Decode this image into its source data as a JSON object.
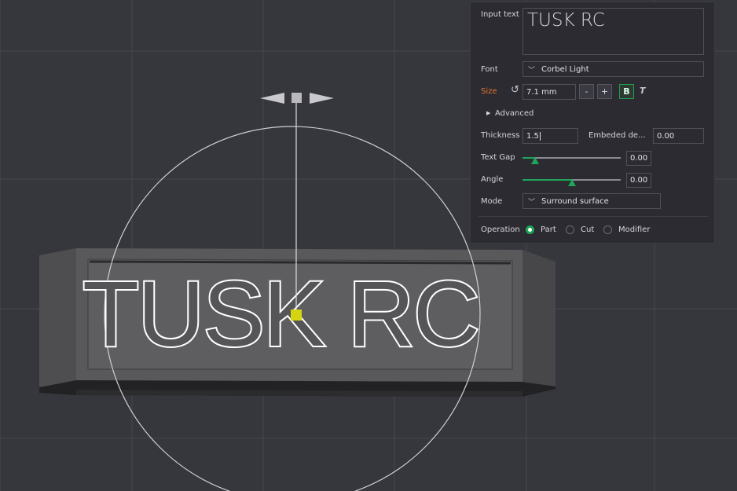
{
  "scene": {
    "embossed_text": "TUSK RC"
  },
  "panel": {
    "input_text_label": "Input text",
    "input_text_value": "TUSK RC",
    "font_label": "Font",
    "font_value": "Corbel Light",
    "size_label": "Size",
    "size_value": "7.1 mm",
    "size_minus": "-",
    "size_plus": "+",
    "bold_label": "B",
    "italic_label": "T",
    "advanced_label": "Advanced",
    "thickness_label": "Thickness",
    "thickness_value": "1.5",
    "embedded_label": "Embeded de...",
    "embedded_value": "0.00",
    "text_gap_label": "Text Gap",
    "text_gap_value": "0.00",
    "text_gap_level": 0.13,
    "angle_label": "Angle",
    "angle_value": "0.00",
    "angle_level": 0.5,
    "mode_label": "Mode",
    "mode_value": "Surround surface",
    "operation_label": "Operation",
    "operation_options": [
      "Part",
      "Cut",
      "Modifier"
    ],
    "operation_selected": "Part",
    "accent_color": "#1fa55a",
    "size_label_color": "#e8742f"
  }
}
